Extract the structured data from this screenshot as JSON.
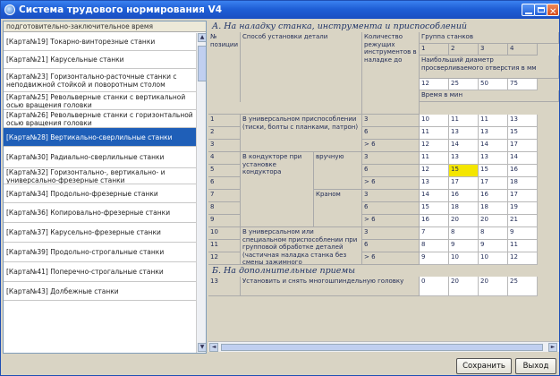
{
  "window": {
    "title": "Система трудового нормирования V4"
  },
  "sidebar": {
    "header": "подготовительно-заключительное время",
    "items": [
      "[Карта№19] Токарно-винторезные станки",
      "[Карта№21] Карусельные станки",
      "[Карта№23] Горизонтально-расточные станки с неподвижной стойкой и поворотным столом",
      "[Карта№25] Револьверные станки с вертикальной осью вращения головки",
      "[Карта№26] Револьверные станки с горизонтальной осью вращения головки",
      "[Карта№28] Вертикально-сверлильные станки",
      "[Карта№30] Радиально-сверлильные станки",
      "[Карта№32] Горизонтально-, вертикально- и универсально-фрезерные станки",
      "[Карта№34] Продольно-фрезерные станки",
      "[Карта№36] Копировально-фрезерные станки",
      "[Карта№37] Карусельно-фрезерные станки",
      "[Карта№39] Продольно-строгальные станки",
      "[Карта№41] Поперечно-строгальные станки",
      "[Карта№43] Долбежные станки"
    ],
    "selected_index": 5
  },
  "table": {
    "section_a": "А. На наладку станка, инструмента и приспособлений",
    "section_b": "Б. На дополнительные приемы",
    "headers": {
      "pos": "№ позиции",
      "method": "Способ установки детали",
      "count": "Количество режущих инструментов в наладке до",
      "group": "Группа станков",
      "groups": [
        "1",
        "2",
        "3",
        "4"
      ],
      "diameter": "Наибольший диаметр просверливаемого отверстия в мм",
      "diameters": [
        "12",
        "25",
        "50",
        "75"
      ],
      "time": "Время в мин"
    },
    "methods": {
      "universal": "В универсальном приспособлении (тиски, болты с планками, патрон)",
      "conductor": "В кондукторе при установке кондуктора",
      "manual": "вручную",
      "crane": "Краном",
      "special": "В универсальном или специальном приспособлении при групповой обработке деталей (частичная наладка станка без смены зажимного приспособления)",
      "multi": "Установить и снять многошпиндельную головку"
    },
    "rows": [
      {
        "pos": "1",
        "cnt": "3",
        "v": [
          "10",
          "11",
          "11",
          "13"
        ]
      },
      {
        "pos": "2",
        "cnt": "6",
        "v": [
          "11",
          "13",
          "13",
          "15"
        ]
      },
      {
        "pos": "3",
        "cnt": "> 6",
        "v": [
          "12",
          "14",
          "14",
          "17"
        ]
      },
      {
        "pos": "4",
        "cnt": "3",
        "v": [
          "11",
          "13",
          "13",
          "14"
        ]
      },
      {
        "pos": "5",
        "cnt": "6",
        "v": [
          "12",
          "15",
          "15",
          "16"
        ]
      },
      {
        "pos": "6",
        "cnt": "> 6",
        "v": [
          "13",
          "17",
          "17",
          "18"
        ]
      },
      {
        "pos": "7",
        "cnt": "3",
        "v": [
          "14",
          "16",
          "16",
          "17"
        ]
      },
      {
        "pos": "8",
        "cnt": "6",
        "v": [
          "15",
          "18",
          "18",
          "19"
        ]
      },
      {
        "pos": "9",
        "cnt": "> 6",
        "v": [
          "16",
          "20",
          "20",
          "21"
        ]
      },
      {
        "pos": "10",
        "cnt": "3",
        "v": [
          "7",
          "8",
          "8",
          "9"
        ]
      },
      {
        "pos": "11",
        "cnt": "6",
        "v": [
          "8",
          "9",
          "9",
          "11"
        ]
      },
      {
        "pos": "12",
        "cnt": "> 6",
        "v": [
          "9",
          "10",
          "10",
          "12"
        ]
      }
    ],
    "row_b": {
      "pos": "13",
      "v": [
        "0",
        "20",
        "20",
        "25"
      ]
    },
    "highlight_color": "#f4e600"
  },
  "footer": {
    "save": "Сохранить",
    "exit": "Выход"
  }
}
